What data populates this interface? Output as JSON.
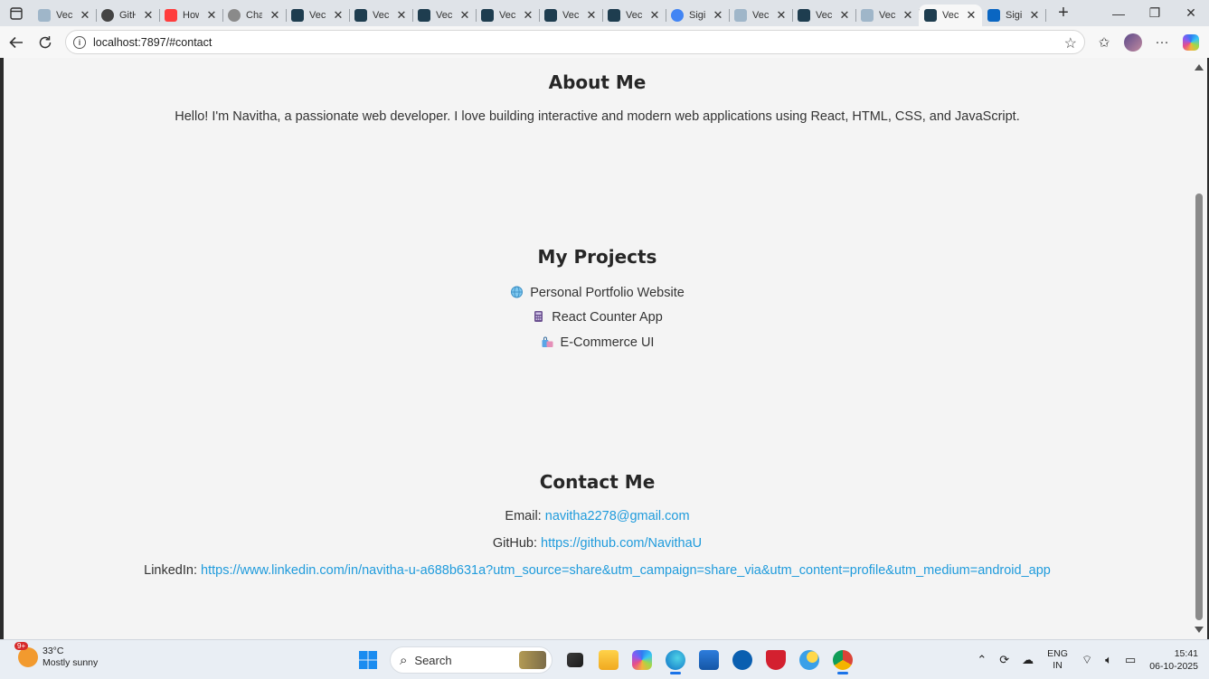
{
  "browser": {
    "tabs": [
      {
        "title": "Vec",
        "favicon": "blue",
        "fav_color": "#9fb6c9"
      },
      {
        "title": "GitH",
        "favicon": "github",
        "fav_color": "#444444"
      },
      {
        "title": "How",
        "favicon": "youtube",
        "fav_color": "#ff3d3d"
      },
      {
        "title": "Cha",
        "favicon": "chatgpt",
        "fav_color": "#8a8a8a"
      },
      {
        "title": "Vec",
        "favicon": "react",
        "fav_color": "#1e3d4f"
      },
      {
        "title": "Vec",
        "favicon": "react",
        "fav_color": "#1e3d4f"
      },
      {
        "title": "Vec",
        "favicon": "react",
        "fav_color": "#1e3d4f"
      },
      {
        "title": "Vec",
        "favicon": "react",
        "fav_color": "#1e3d4f"
      },
      {
        "title": "Vec",
        "favicon": "react",
        "fav_color": "#1e3d4f"
      },
      {
        "title": "Vec",
        "favicon": "react",
        "fav_color": "#1e3d4f"
      },
      {
        "title": "Sigi",
        "favicon": "google",
        "fav_color": "#4285f4"
      },
      {
        "title": "Vec",
        "favicon": "blue",
        "fav_color": "#9fb6c9"
      },
      {
        "title": "Vec",
        "favicon": "react",
        "fav_color": "#1e3d4f"
      },
      {
        "title": "Vec",
        "favicon": "blue",
        "fav_color": "#9fb6c9"
      },
      {
        "title": "Vec",
        "favicon": "react",
        "fav_color": "#1e3d4f",
        "active": true
      },
      {
        "title": "Sigi",
        "favicon": "linkedin",
        "fav_color": "#0a66c2"
      }
    ],
    "url": "localhost:7897/#contact"
  },
  "page": {
    "about": {
      "title": "About Me",
      "text": "Hello! I'm Navitha, a passionate web developer. I love building interactive and modern web applications using React, HTML, CSS, and JavaScript."
    },
    "projects": {
      "title": "My Projects",
      "items": [
        {
          "icon": "globe-icon",
          "label": "Personal Portfolio Website"
        },
        {
          "icon": "calculator-icon",
          "label": "React Counter App"
        },
        {
          "icon": "shopping-bags-icon",
          "label": "E-Commerce UI"
        }
      ]
    },
    "contact": {
      "title": "Contact Me",
      "email_label": "Email:",
      "email": "navitha2278@gmail.com",
      "github_label": "GitHub:",
      "github": "https://github.com/NavithaU",
      "linkedin_label": "LinkedIn:",
      "linkedin": "https://www.linkedin.com/in/navitha-u-a688b631a?utm_source=share&utm_campaign=share_via&utm_content=profile&utm_medium=android_app"
    },
    "link_color": "#1f9bdc"
  },
  "taskbar": {
    "weather_temp": "33°C",
    "weather_desc": "Mostly sunny",
    "weather_badge": "9+",
    "search_label": "Search",
    "lang_top": "ENG",
    "lang_bottom": "IN",
    "time": "15:41",
    "date": "06-10-2025"
  }
}
